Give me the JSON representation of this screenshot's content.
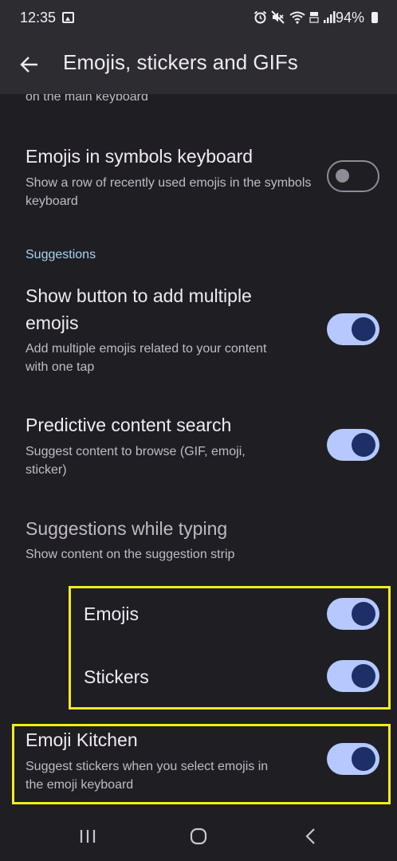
{
  "status": {
    "time": "12:35",
    "battery": "94%"
  },
  "header": {
    "title": "Emojis, stickers and GIFs"
  },
  "clipped": {
    "text": "on the main keyboard"
  },
  "settings": {
    "emoji_symbols": {
      "title": "Emojis in symbols keyboard",
      "subtitle": "Show a row of recently used emojis in the symbols keyboard",
      "enabled": false
    },
    "section": "Suggestions",
    "multiple_emojis": {
      "title_line1": "Show button to add multiple",
      "title_line2": "emojis",
      "subtitle_line1": "Add multiple emojis related to your content",
      "subtitle_line2": "with one tap",
      "enabled": true
    },
    "predictive": {
      "title": "Predictive content search",
      "subtitle_line1": "Suggest content to browse (GIF, emoji,",
      "subtitle_line2": "sticker)",
      "enabled": true
    },
    "while_typing": {
      "title": "Suggestions while typing",
      "subtitle": "Show content on the suggestion strip"
    },
    "emojis": {
      "title": "Emojis",
      "enabled": true
    },
    "stickers": {
      "title": "Stickers",
      "enabled": true
    },
    "emoji_kitchen": {
      "title": "Emoji Kitchen",
      "subtitle_line1": "Suggest stickers when you select emojis in",
      "subtitle_line2": "the emoji keyboard",
      "enabled": true
    }
  },
  "colors": {
    "accent_track": "#b5c8ff",
    "accent_knob": "#1c2f66",
    "highlight": "#f2ec1d",
    "section": "#a7d2f4"
  },
  "icons": {
    "back": "arrow-left-icon",
    "recents": "recents-icon",
    "home": "home-icon",
    "nav_back": "chevron-left-icon"
  }
}
